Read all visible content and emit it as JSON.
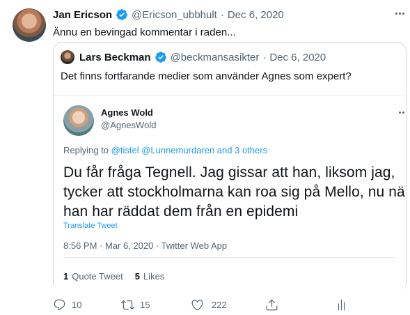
{
  "tweet": {
    "author_name": "Jan Ericson",
    "handle": "@Ericson_ubbhult",
    "separator": "·",
    "date": "Dec 6, 2020",
    "text": "Ännu en bevingad kommentar i raden...",
    "actions": {
      "reply_count": "10",
      "retweet_count": "15",
      "like_count": "222"
    }
  },
  "quoted_tweet": {
    "author_name": "Lars Beckman",
    "handle": "@beckmansasikter",
    "separator": "·",
    "date": "Dec 6, 2020",
    "text": "Det finns fortfarande medier som använder Agnes som expert?"
  },
  "embedded_screenshot": {
    "author_name": "Agnes Wold",
    "handle": "@AgnesWold",
    "replying_prefix": "Replying to",
    "replying_to": "@tistel @Lunnemurdaren and 3 others",
    "text_lines": [
      "Du får fråga Tegnell. Jag gissar att han, liksom jag,",
      "tycker att stockholmarna kan roa sig på Mello, nu när",
      "han har räddat dem från en epidemi"
    ],
    "translate_label": "Translate Tweet",
    "timestamp": "8:56 PM · Mar 6, 2020 · Twitter Web App",
    "quote_tweet_count": "1",
    "quote_tweet_label": "Quote Tweet",
    "likes_count": "5",
    "likes_label": "Likes"
  },
  "colors": {
    "accent": "#1d9bf0",
    "muted": "#536471",
    "border": "#cfd9de"
  },
  "icons": [
    "more-icon",
    "verified-badge-icon",
    "reply-icon",
    "retweet-icon",
    "like-icon",
    "share-icon",
    "analytics-icon"
  ]
}
